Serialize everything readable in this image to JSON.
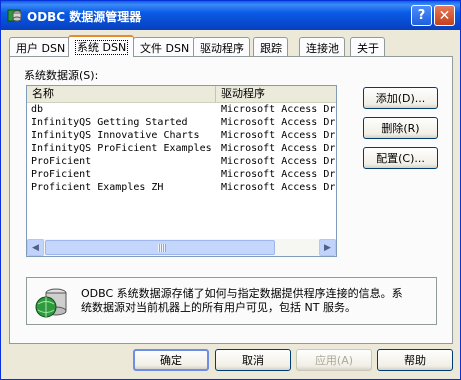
{
  "window": {
    "title": "ODBC 数据源管理器"
  },
  "titlebar": {
    "help_label": "?",
    "close_label": "✕"
  },
  "tabs": [
    {
      "label": "用户 DSN",
      "active": false
    },
    {
      "label": "系统 DSN",
      "active": true
    },
    {
      "label": "文件 DSN",
      "active": false
    },
    {
      "label": "驱动程序",
      "active": false
    },
    {
      "label": "跟踪",
      "active": false
    },
    {
      "label": "连接池",
      "active": false
    },
    {
      "label": "关于",
      "active": false
    }
  ],
  "section_label": "系统数据源(S):",
  "list": {
    "columns": {
      "name": "名称",
      "driver": "驱动程序"
    },
    "rows": [
      {
        "name": "db",
        "driver": "Microsoft Access Dr"
      },
      {
        "name": "InfinityQS Getting Started",
        "driver": "Microsoft Access Dr"
      },
      {
        "name": "InfinityQS Innovative Charts",
        "driver": "Microsoft Access Dr"
      },
      {
        "name": "InfinityQS ProFicient Examples",
        "driver": "Microsoft Access Dr"
      },
      {
        "name": "ProFicient",
        "driver": "Microsoft Access Dr"
      },
      {
        "name": "ProFicient",
        "driver": "Microsoft Access Dr"
      },
      {
        "name": "Proficient Examples ZH",
        "driver": "Microsoft Access Dr"
      }
    ]
  },
  "side_buttons": {
    "add": "添加(D)...",
    "remove": "删除(R)",
    "configure": "配置(C)..."
  },
  "info": {
    "line1": "ODBC 系统数据源存储了如何与指定数据提供程序连接的信息。系",
    "line2": "统数据源对当前机器上的所有用户可见，包括 NT 服务。"
  },
  "footer_buttons": {
    "ok": "确定",
    "cancel": "取消",
    "apply": "应用(A)",
    "help": "帮助"
  },
  "colors": {
    "titlebar": "#0a5be5",
    "active_tab_accent": "#e68b2c",
    "face": "#ece9d8"
  },
  "icons": {
    "app": "odbc-app-icon",
    "info": "database-globe-icon"
  }
}
